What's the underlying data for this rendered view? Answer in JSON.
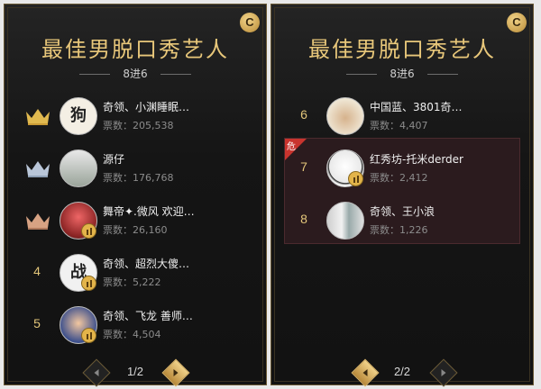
{
  "panels": [
    {
      "badge": "C",
      "title": "最佳男脱口秀艺人",
      "round": "8进6",
      "entries": [
        {
          "rank": "",
          "medal": "gold-crown-icon",
          "name": "奇领、小渊睡眠…",
          "votes_label": "票数：",
          "votes": "205,538",
          "avatar": "狗"
        },
        {
          "rank": "",
          "medal": "silver-crown-icon",
          "name": "源仔",
          "votes_label": "票数：",
          "votes": "176,768",
          "avatar": ""
        },
        {
          "rank": "",
          "medal": "bronze-crown-icon",
          "name": "舞帝✦.微风 欢迎…",
          "votes_label": "票数：",
          "votes": "26,160",
          "avatar": ""
        },
        {
          "rank": "4",
          "medal": "",
          "name": "奇领、超烈大傻…",
          "votes_label": "票数：",
          "votes": "5,222",
          "avatar": "战"
        },
        {
          "rank": "5",
          "medal": "",
          "name": "奇领、飞龙 善师…",
          "votes_label": "票数：",
          "votes": "4,504",
          "avatar": ""
        }
      ],
      "pager": "1/2"
    },
    {
      "badge": "C",
      "title": "最佳男脱口秀艺人",
      "round": "8进6",
      "entries": [
        {
          "rank": "6",
          "name": "中国蓝、3801奇…",
          "votes_label": "票数：",
          "votes": "4,407",
          "avatar": ""
        },
        {
          "rank": "7",
          "name": "红秀坊-托米derder",
          "votes_label": "票数：",
          "votes": "2,412",
          "avatar": ""
        },
        {
          "rank": "8",
          "name": "奇领、王小浪",
          "votes_label": "票数：",
          "votes": "1,226",
          "avatar": ""
        }
      ],
      "danger_label": "危",
      "pager": "2/2"
    }
  ],
  "colors": {
    "gold": "#e8c77a",
    "danger": "#c8342e"
  }
}
